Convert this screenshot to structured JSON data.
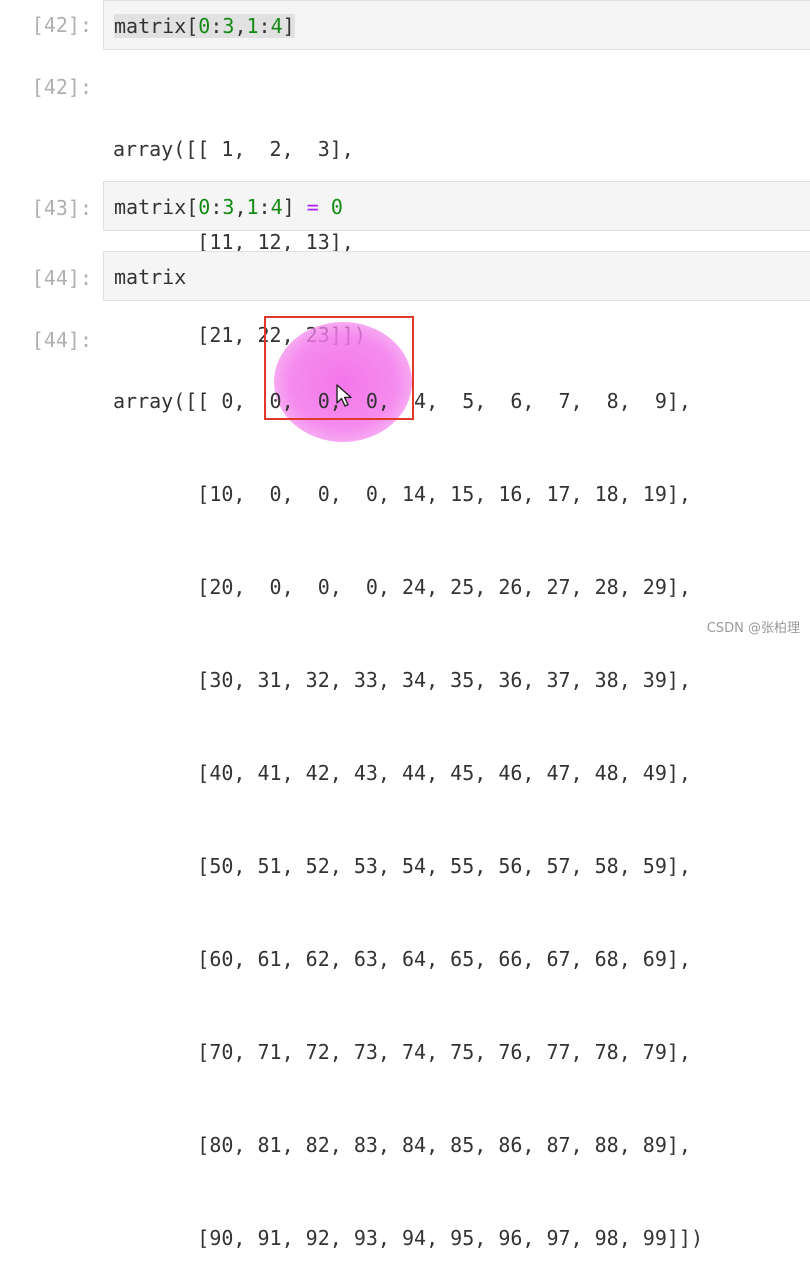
{
  "cells": [
    {
      "prompt": "[42]:",
      "code": {
        "head": "matrix",
        "b1": "[",
        "n1": "0",
        "c1": ":",
        "n2": "3",
        "c2": ",",
        "n3": "1",
        "c3": ":",
        "n4": "4",
        "b2": "]"
      }
    },
    {
      "prompt": "[43]:",
      "code": {
        "head": "matrix[",
        "n1": "0",
        "c1": ":",
        "n2": "3",
        "c2": ",",
        "n3": "1",
        "c3": ":",
        "n4": "4",
        "b2": "] ",
        "op": "=",
        "sp": " ",
        "n5": "0"
      }
    },
    {
      "prompt": "[44]:",
      "code": {
        "head": "matrix"
      }
    }
  ],
  "outputs": [
    {
      "prompt": "[42]:",
      "lines": [
        "array([[ 1,  2,  3],",
        "       [11, 12, 13],",
        "       [21, 22, 23]])"
      ]
    },
    {
      "prompt": "[44]:",
      "lines": [
        "array([[ 0,  0,  0,  0,  4,  5,  6,  7,  8,  9],",
        "       [10,  0,  0,  0, 14, 15, 16, 17, 18, 19],",
        "       [20,  0,  0,  0, 24, 25, 26, 27, 28, 29],",
        "       [30, 31, 32, 33, 34, 35, 36, 37, 38, 39],",
        "       [40, 41, 42, 43, 44, 45, 46, 47, 48, 49],",
        "       [50, 51, 52, 53, 54, 55, 56, 57, 58, 59],",
        "       [60, 61, 62, 63, 64, 65, 66, 67, 68, 69],",
        "       [70, 71, 72, 73, 74, 75, 76, 77, 78, 79],",
        "       [80, 81, 82, 83, 84, 85, 86, 87, 88, 89],",
        "       [90, 91, 92, 93, 94, 95, 96, 97, 98, 99]])"
      ]
    }
  ],
  "watermark": "CSDN @张柏理",
  "colors": {
    "number": "#138a13",
    "operator": "#aa22ff",
    "prompt": "#b0b0b0",
    "highlight_box": "#e23a2a",
    "highlight_circle": "#f36ee8"
  },
  "icons": {
    "cursor": "mouse-pointer-icon"
  }
}
